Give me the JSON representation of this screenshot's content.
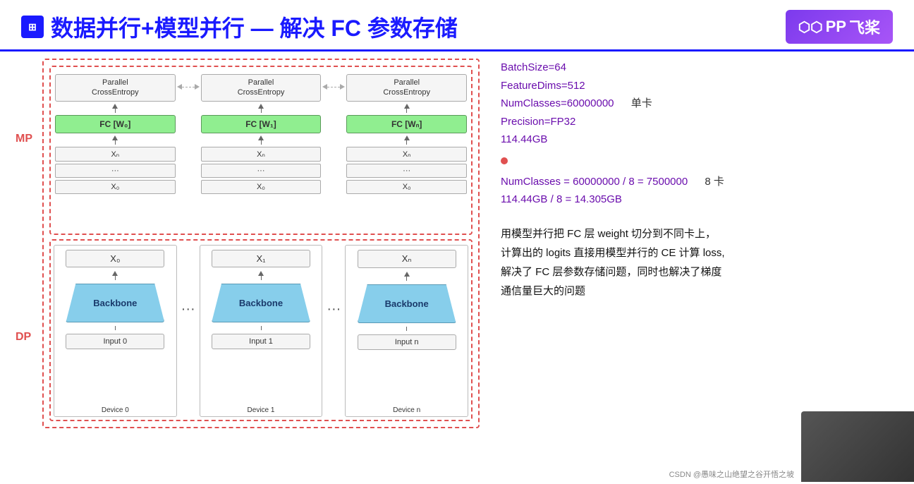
{
  "header": {
    "icon_text": "⊞",
    "title": "数据并行+模型并行 — 解决 FC 参数存储",
    "logo_text": "飞桨",
    "logo_prefix": "PP"
  },
  "labels": {
    "mp": "MP",
    "dp": "DP"
  },
  "mp_devices": [
    {
      "parallel_label": "Parallel\nCrossEntropy",
      "fc_label": "FC [W₀]",
      "rows": [
        "Xₙ",
        "...",
        "X₀"
      ]
    },
    {
      "parallel_label": "Parallel\nCrossEntropy",
      "fc_label": "FC [W₁]",
      "rows": [
        "Xₙ",
        "...",
        "X₀"
      ]
    },
    {
      "parallel_label": "Parallel\nCrossEntropy",
      "fc_label": "FC [Wₙ]",
      "rows": [
        "Xₙ",
        "...",
        "X₀"
      ]
    }
  ],
  "dp_devices": [
    {
      "x_label": "X₀",
      "backbone": "Backbone",
      "input": "Input 0",
      "device": "Device 0"
    },
    {
      "x_label": "X₁",
      "backbone": "Backbone",
      "input": "Input 1",
      "device": "Device 1"
    },
    {
      "x_label": "Xₙ",
      "backbone": "Backbone",
      "input": "Input n",
      "device": "Device n"
    }
  ],
  "stats": {
    "line1": "BatchSize=64",
    "line2": "FeatureDims=512",
    "line3": "NumClasses=60000000",
    "line4": "Precision=FP32",
    "line5": "114.44GB",
    "unit_label": "单卡"
  },
  "stats2": {
    "line1": "NumClasses = 60000000 / 8 = 7500000",
    "line2": "114.44GB / 8 = 14.305GB",
    "unit_label": "8 卡"
  },
  "description": "用模型并行把 FC 层 weight 切分到不同卡上，\n计算出的 logits 直接用模型并行的 CE 计算 loss,\n解决了 FC 层参数存储问题，同时也解决了梯度\n通信量巨大的问题",
  "watermark": "CSDN @愚味之山绝望之谷开悟之坡"
}
